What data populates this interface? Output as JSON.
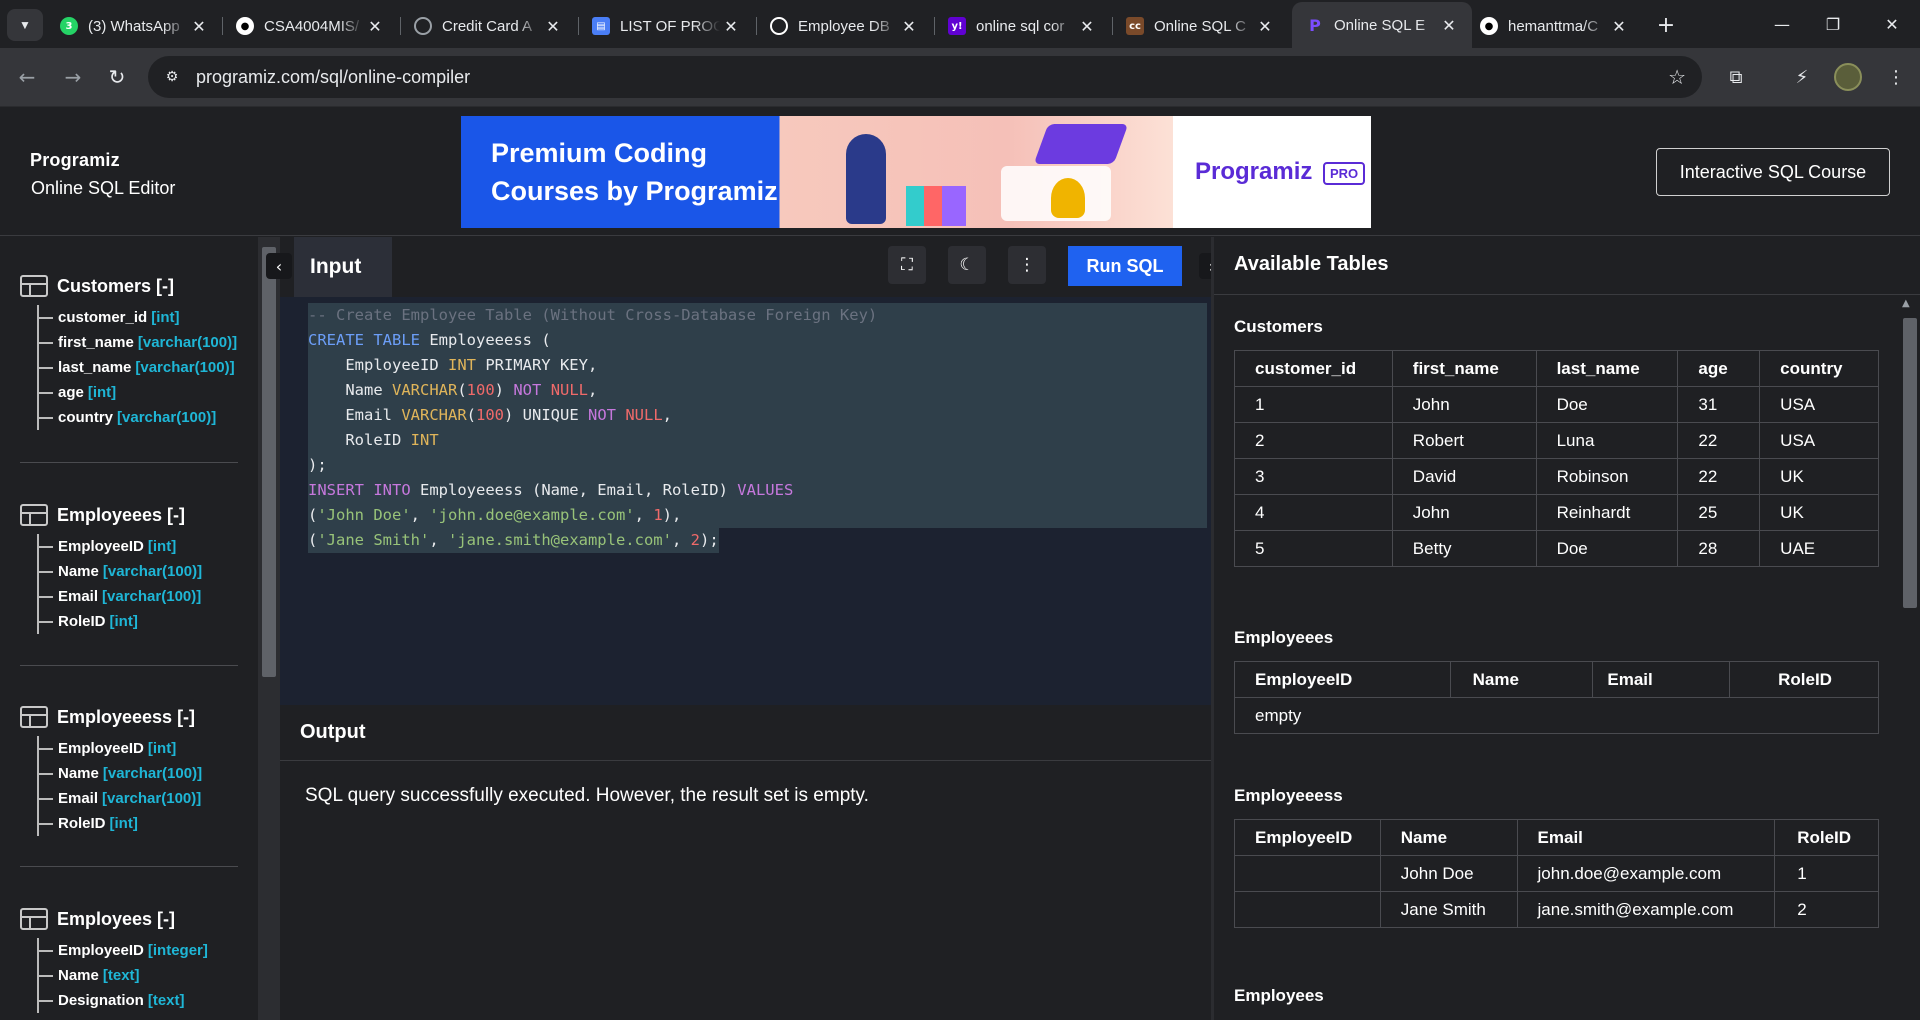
{
  "browser": {
    "tabs": [
      {
        "title": "(3) WhatsApp",
        "favicon": "whatsapp-icon",
        "color": "#25d366"
      },
      {
        "title": "CSA4004MIS/",
        "favicon": "github-icon",
        "color": "#ffffff"
      },
      {
        "title": "Credit Card A",
        "favicon": "globe-icon",
        "color": "#9aa0a6"
      },
      {
        "title": "LIST OF PROG",
        "favicon": "doc-icon",
        "color": "#4a7ef6"
      },
      {
        "title": "Employee DB",
        "favicon": "openai-icon",
        "color": "#ffffff"
      },
      {
        "title": "online sql cor",
        "favicon": "yahoo-icon",
        "color": "#6001d2"
      },
      {
        "title": "Online SQL C",
        "favicon": "cc-icon",
        "color": "#7a4a2a"
      },
      {
        "title": "Online SQL E",
        "favicon": "programiz-icon",
        "color": "#5a2bd6"
      },
      {
        "title": "hemanttma/C",
        "favicon": "github-icon",
        "color": "#ffffff"
      }
    ],
    "url": "programiz.com/sql/online-compiler"
  },
  "header": {
    "logo": "Programiz",
    "site_name": "Online SQL Editor",
    "banner_line1": "Premium Coding",
    "banner_line2": "Courses by Programiz",
    "banner_brand": "Programiz",
    "banner_pro": "PRO",
    "course_button": "Interactive SQL Course"
  },
  "schema": [
    {
      "name": "Customers [-]",
      "columns": [
        {
          "name": "customer_id",
          "type": "[int]"
        },
        {
          "name": "first_name",
          "type": "[varchar(100)]"
        },
        {
          "name": "last_name",
          "type": "[varchar(100)]"
        },
        {
          "name": "age",
          "type": "[int]"
        },
        {
          "name": "country",
          "type": "[varchar(100)]"
        }
      ]
    },
    {
      "name": "Employeees [-]",
      "columns": [
        {
          "name": "EmployeeID",
          "type": "[int]"
        },
        {
          "name": "Name",
          "type": "[varchar(100)]"
        },
        {
          "name": "Email",
          "type": "[varchar(100)]"
        },
        {
          "name": "RoleID",
          "type": "[int]"
        }
      ]
    },
    {
      "name": "Employeeess [-]",
      "columns": [
        {
          "name": "EmployeeID",
          "type": "[int]"
        },
        {
          "name": "Name",
          "type": "[varchar(100)]"
        },
        {
          "name": "Email",
          "type": "[varchar(100)]"
        },
        {
          "name": "RoleID",
          "type": "[int]"
        }
      ]
    },
    {
      "name": "Employees [-]",
      "columns": [
        {
          "name": "EmployeeID",
          "type": "[integer]"
        },
        {
          "name": "Name",
          "type": "[text]"
        },
        {
          "name": "Designation",
          "type": "[text]"
        }
      ]
    }
  ],
  "editor": {
    "tab_label": "Input",
    "run_label": "Run SQL",
    "code": {
      "comment": "-- Create Employee Table (Without Cross-Database Foreign Key)",
      "create": "CREATE",
      "table": "TABLE",
      "table_name": " Employeeess (",
      "col1": "    EmployeeID ",
      "col1_type": "INT",
      "col1_rest": " PRIMARY KEY,",
      "col2": "    Name ",
      "col2_type": "VARCHAR",
      "col2_len": "100",
      "not": "NOT",
      "null": "NULL",
      "col3": "    Email ",
      "col3_type": "VARCHAR",
      "col3_len": "100",
      "unique": " UNIQUE ",
      "col4": "    RoleID ",
      "col4_type": "INT",
      "close": ");",
      "insert": "INSERT",
      "into": "INTO",
      "insert_target": " Employeeess (Name, Email, RoleID) ",
      "values_kw": "VALUES",
      "row1_str1": "'John Doe'",
      "row1_str2": "'john.doe@example.com'",
      "row1_num": "1",
      "row2_str1": "'Jane Smith'",
      "row2_str2": "'jane.smith@example.com'",
      "row2_num": "2"
    }
  },
  "output": {
    "label": "Output",
    "message": "SQL query successfully executed. However, the result set is empty."
  },
  "tables_panel": {
    "title": "Available Tables",
    "customers": {
      "title": "Customers",
      "headers": [
        "customer_id",
        "first_name",
        "last_name",
        "age",
        "country"
      ],
      "rows": [
        [
          "1",
          "John",
          "Doe",
          "31",
          "USA"
        ],
        [
          "2",
          "Robert",
          "Luna",
          "22",
          "USA"
        ],
        [
          "3",
          "David",
          "Robinson",
          "22",
          "UK"
        ],
        [
          "4",
          "John",
          "Reinhardt",
          "25",
          "UK"
        ],
        [
          "5",
          "Betty",
          "Doe",
          "28",
          "UAE"
        ]
      ]
    },
    "employeees": {
      "title": "Employeees",
      "headers": [
        "EmployeeID",
        "Name",
        "Email",
        "RoleID"
      ],
      "empty": "empty"
    },
    "employeeess": {
      "title": "Employeeess",
      "headers": [
        "EmployeeID",
        "Name",
        "Email",
        "RoleID"
      ],
      "rows": [
        [
          "",
          "John Doe",
          "john.doe@example.com",
          "1"
        ],
        [
          "",
          "Jane Smith",
          "jane.smith@example.com",
          "2"
        ]
      ]
    },
    "employees": {
      "title": "Employees"
    }
  },
  "colors": {
    "accent": "#1f62f0",
    "type_color": "#1fb6d6",
    "brand": "#5a2bd6"
  }
}
